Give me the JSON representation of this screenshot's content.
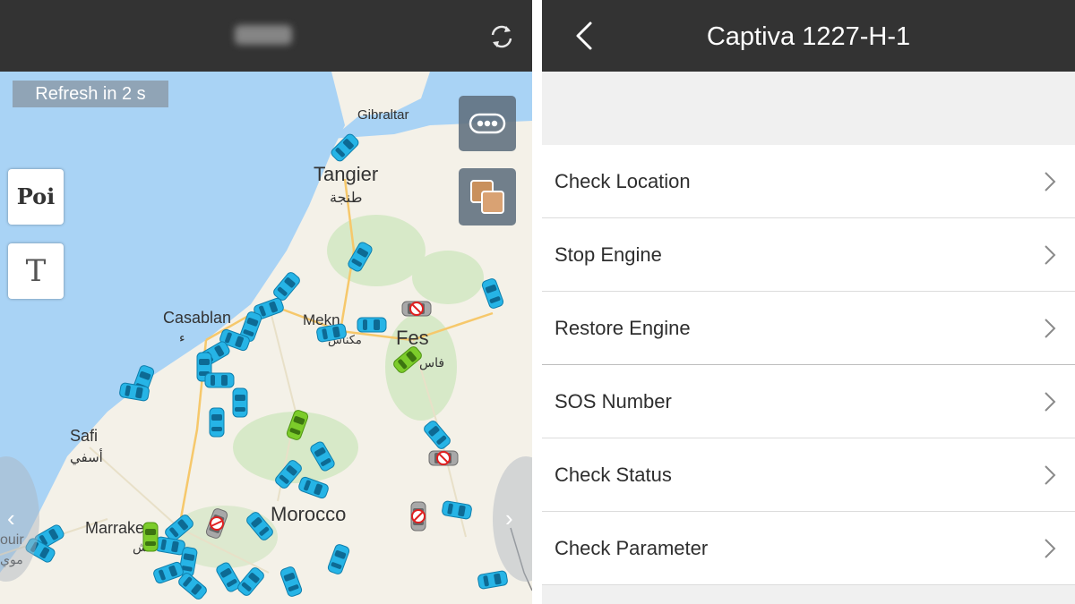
{
  "map_screen": {
    "refresh_badge": "Refresh in 2 s",
    "poi_button": "Poi",
    "text_button": "T",
    "icons": {
      "refresh": "refresh-icon",
      "more": "more-icon",
      "layers": "layers-icon",
      "prev": "chevron-left-icon",
      "next": "chevron-right-icon"
    },
    "prev_glyph": "‹",
    "next_glyph": "›",
    "map_labels": {
      "gibraltar": "Gibraltar",
      "tangier": "Tangier",
      "tangier_ar": "طنجة",
      "casablanca": "Casablan",
      "casablanca_ar": "ء",
      "meknes": "Mekn",
      "meknes_ar": "مكناس",
      "fes": "Fes",
      "fes_ar": "فاس",
      "safi": "Safi",
      "safi_ar": "أسفي",
      "morocco": "Morocco",
      "marrakech": "Marrake",
      "marrakech_ar": "ش",
      "essaouira": "ouir",
      "essaouira_ar": "موي"
    },
    "colors": {
      "header": "#333333",
      "sea": "#a9d3f5",
      "land": "#f4f1e8",
      "car_online": "#26b4e6",
      "car_idle": "#7ccc2a",
      "car_offline": "#9e9e9e"
    }
  },
  "detail_screen": {
    "title": "Captiva 1227-H-1",
    "back_icon": "chevron-left-icon",
    "items": [
      {
        "label": "Check Location"
      },
      {
        "label": "Stop Engine"
      },
      {
        "label": "Restore Engine"
      },
      {
        "label": "SOS Number"
      },
      {
        "label": "Check Status"
      },
      {
        "label": "Check Parameter"
      }
    ]
  }
}
